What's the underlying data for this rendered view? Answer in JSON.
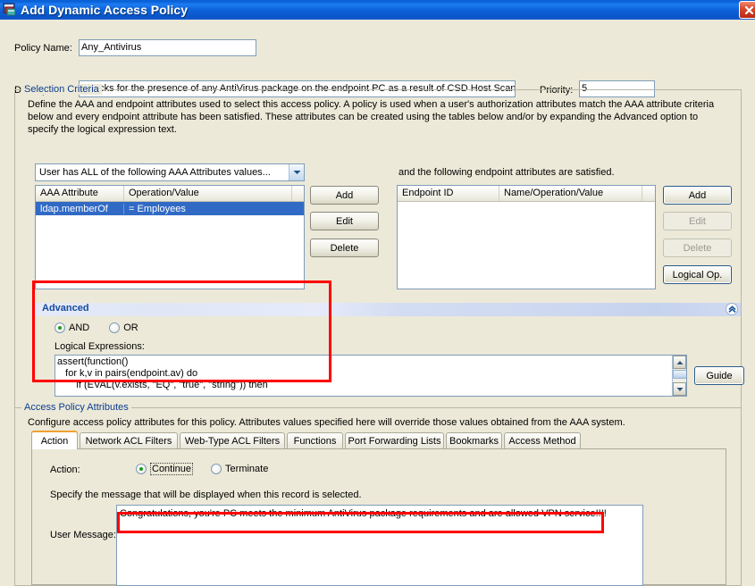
{
  "window": {
    "title": "Add Dynamic Access Policy",
    "icon": "policy-window-icon",
    "close_label": "✖"
  },
  "form": {
    "policy_name_label": "Policy Name:",
    "policy_name_value": "Any_Antivirus",
    "description_label": "Description:",
    "description_value": "Checks for the presence of any AntiVirus package on the endpoint PC as a result of CSD Host Scan",
    "priority_label": "Priority:",
    "priority_value": "5"
  },
  "selection_criteria": {
    "group_title": "Selection Criteria",
    "description": "Define the AAA and endpoint attributes used to select this access policy. A policy is used when a user's authorization attributes match the AAA attribute criteria below and every endpoint attribute has been satisfied. These attributes can be created using the tables below and/or by expanding the Advanced option to specify the logical expression text.",
    "aaa_select_value": "User has ALL of the following AAA Attributes values...",
    "endpoint_intro": "and the following endpoint attributes are satisfied.",
    "aaa_table": {
      "columns": [
        "AAA Attribute",
        "Operation/Value"
      ],
      "rows": [
        {
          "attribute": "ldap.memberOf",
          "operation_value": "=   Employees",
          "selected": true
        }
      ]
    },
    "aaa_buttons": [
      {
        "label": "Add",
        "enabled": true
      },
      {
        "label": "Edit",
        "enabled": true
      },
      {
        "label": "Delete",
        "enabled": true
      }
    ],
    "endpoint_table": {
      "columns": [
        "Endpoint ID",
        "Name/Operation/Value"
      ],
      "rows": []
    },
    "endpoint_buttons": [
      {
        "label": "Add",
        "enabled": true
      },
      {
        "label": "Edit",
        "enabled": false
      },
      {
        "label": "Delete",
        "enabled": false
      },
      {
        "label": "Logical Op.",
        "enabled": true
      }
    ]
  },
  "advanced": {
    "title": "Advanced",
    "collapse_icon": "«",
    "operator_and": "AND",
    "operator_or": "OR",
    "selected_operator": "AND",
    "logical_expressions_label": "Logical Expressions:",
    "logical_expressions_value": "assert(function()\n   for k,v in pairs(endpoint.av) do\n       if (EVAL(v.exists, \"EQ\", \"true\", \"string\")) then",
    "guide_label": "Guide"
  },
  "access_policy_attributes": {
    "group_title": "Access Policy Attributes",
    "description": "Configure access policy attributes for this policy. Attributes values specified here will override those values obtained from the AAA system.",
    "tabs": [
      {
        "label": "Action",
        "active": true
      },
      {
        "label": "Network ACL Filters",
        "active": false
      },
      {
        "label": "Web-Type ACL Filters",
        "active": false
      },
      {
        "label": "Functions",
        "active": false
      },
      {
        "label": "Port Forwarding Lists",
        "active": false
      },
      {
        "label": "Bookmarks",
        "active": false
      },
      {
        "label": "Access Method",
        "active": false
      }
    ],
    "action": {
      "label": "Action:",
      "continue_label": "Continue",
      "terminate_label": "Terminate",
      "selected": "Continue",
      "message_hint": "Specify the message that will be displayed when this record is selected.",
      "user_message_label": "User Message:",
      "user_message_value": "Congratulations, you're PC meets the minimum AntiVirus package requirements and are allowed VPN service!!!!"
    }
  },
  "annotations": {
    "highlight_color": "#ff0000",
    "boxes": [
      "advanced-section-highlight",
      "user-message-highlight"
    ]
  }
}
